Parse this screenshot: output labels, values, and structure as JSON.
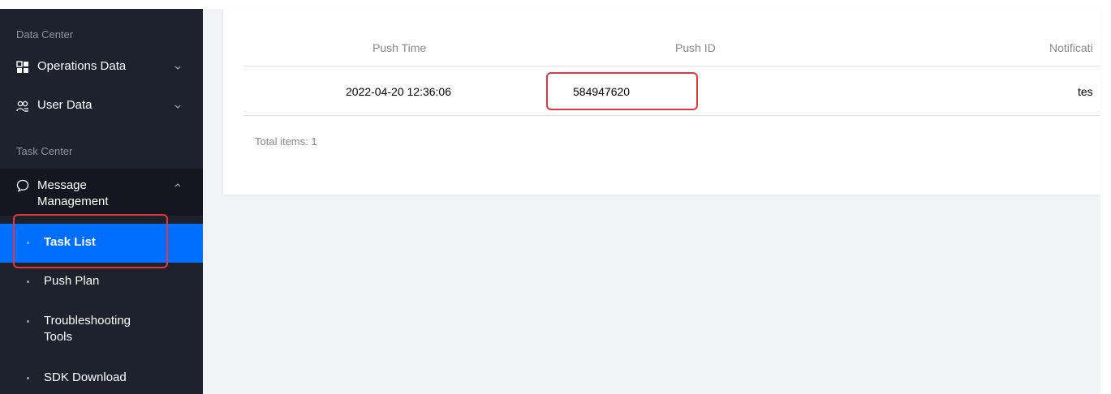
{
  "sidebar": {
    "sections": [
      {
        "title": "Data Center"
      },
      {
        "title": "Task Center"
      }
    ],
    "items": [
      {
        "label": "Operations Data",
        "icon": "grid-icon"
      },
      {
        "label": "User Data",
        "icon": "users-icon"
      }
    ],
    "message_management": {
      "label_line1": "Message",
      "label_line2": "Management",
      "icon": "chat-bubble-icon",
      "subitems": [
        {
          "label": "Task List",
          "active": true
        },
        {
          "label": "Push Plan"
        },
        {
          "label_line1": "Troubleshooting",
          "label_line2": "Tools"
        },
        {
          "label": "SDK Download"
        }
      ]
    }
  },
  "table": {
    "columns": [
      "Push Time",
      "Push ID",
      "Notificati"
    ],
    "rows": [
      {
        "push_time": "2022-04-20 12:36:06",
        "push_id": "584947620",
        "notification": "tes"
      }
    ],
    "total_text": "Total items: 1"
  },
  "colors": {
    "sidebar_bg": "#1e222d",
    "active_bg": "#006eff",
    "highlight_border": "#e0383e",
    "page_bg": "#f2f3f6"
  }
}
